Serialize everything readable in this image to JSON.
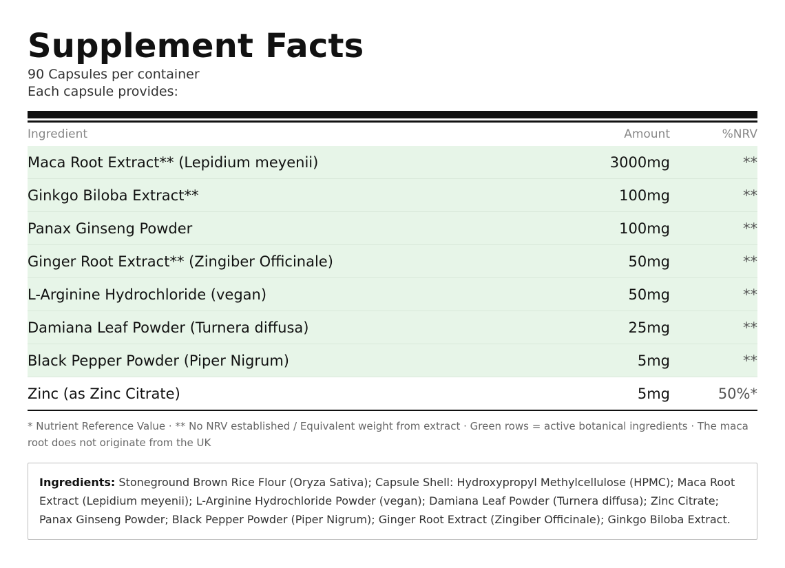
{
  "header": {
    "title": "Supplement Facts",
    "servings": "90 Capsules per container",
    "serving_note": "Each capsule provides:"
  },
  "table": {
    "columns": [
      "Ingredient",
      "Amount",
      "%NRV"
    ],
    "rows": [
      {
        "name": "Maca Root Extract** (Lepidium meyenii)",
        "amount": "3000mg",
        "nrv": "**",
        "highlight": true
      },
      {
        "name": "Ginkgo Biloba Extract**",
        "amount": "100mg",
        "nrv": "**",
        "highlight": true
      },
      {
        "name": "Panax Ginseng Powder",
        "amount": "100mg",
        "nrv": "**",
        "highlight": true
      },
      {
        "name": "Ginger Root Extract** (Zingiber Officinale)",
        "amount": "50mg",
        "nrv": "**",
        "highlight": true
      },
      {
        "name": "L-Arginine Hydrochloride (vegan)",
        "amount": "50mg",
        "nrv": "**",
        "highlight": true
      },
      {
        "name": "Damiana Leaf Powder (Turnera diffusa)",
        "amount": "25mg",
        "nrv": "**",
        "highlight": true
      },
      {
        "name": "Black Pepper Powder (Piper Nigrum)",
        "amount": "5mg",
        "nrv": "**",
        "highlight": true
      },
      {
        "name": "Zinc (as Zinc Citrate)",
        "amount": "5mg",
        "nrv": "50%*",
        "highlight": false
      }
    ]
  },
  "footnote": "* Nutrient Reference Value  ·  ** No NRV established / Equivalent weight from extract  ·  Green rows = active botanical ingredients  ·  The maca root does not originate from the UK",
  "ingredients": {
    "label": "Ingredients:",
    "text": " Stoneground Brown Rice Flour (Oryza Sativa); Capsule Shell: Hydroxypropyl Methylcellulose (HPMC); Maca Root Extract (Lepidium meyenii); L-Arginine Hydrochloride Powder (vegan); Damiana Leaf Powder (Turnera diffusa); Zinc Citrate; Panax Ginseng Powder; Black Pepper Powder (Piper Nigrum); Ginger Root Extract (Zingiber Officinale); Ginkgo Biloba Extract."
  },
  "colors": {
    "highlight_row": "#e7f5e8",
    "rule": "#111111"
  }
}
